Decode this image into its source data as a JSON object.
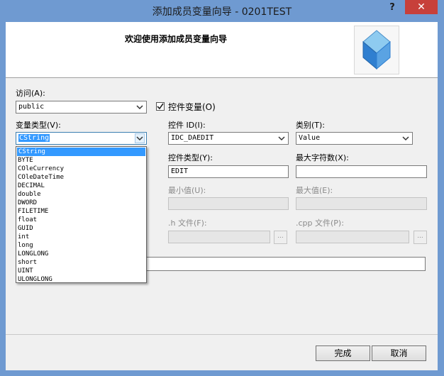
{
  "window": {
    "title": "添加成员变量向导 - 0201TEST",
    "help": "?",
    "close": "✕"
  },
  "header": {
    "title": "欢迎使用添加成员变量向导",
    "icon": "wizard-cube-icon"
  },
  "access": {
    "label": "访问(A):",
    "value": "public"
  },
  "control_var": {
    "label": "控件变量(O)",
    "checked": true
  },
  "var_type": {
    "label": "变量类型(V):",
    "value": "CString"
  },
  "control_id": {
    "label": "控件 ID(I):",
    "value": "IDC_DAEDIT"
  },
  "category": {
    "label": "类别(T):",
    "value": "Value"
  },
  "control_type": {
    "label": "控件类型(Y):",
    "value": "EDIT"
  },
  "max_chars": {
    "label": "最大字符数(X):",
    "value": ""
  },
  "min_value": {
    "label": "最小值(U):",
    "value": ""
  },
  "max_value": {
    "label": "最大值(E):",
    "value": ""
  },
  "h_file": {
    "label": ".h 文件(F):",
    "value": "",
    "browse": "..."
  },
  "cpp_file": {
    "label": ".cpp 文件(P):",
    "value": "",
    "browse": "..."
  },
  "dropdown": {
    "options": [
      "CString",
      "BYTE",
      "COleCurrency",
      "COleDateTime",
      "DECIMAL",
      "double",
      "DWORD",
      "FILETIME",
      "float",
      "GUID",
      "int",
      "long",
      "LONGLONG",
      "short",
      "UINT",
      "ULONGLONG"
    ],
    "selected": "CString"
  },
  "buttons": {
    "finish": "完成",
    "cancel": "取消"
  }
}
